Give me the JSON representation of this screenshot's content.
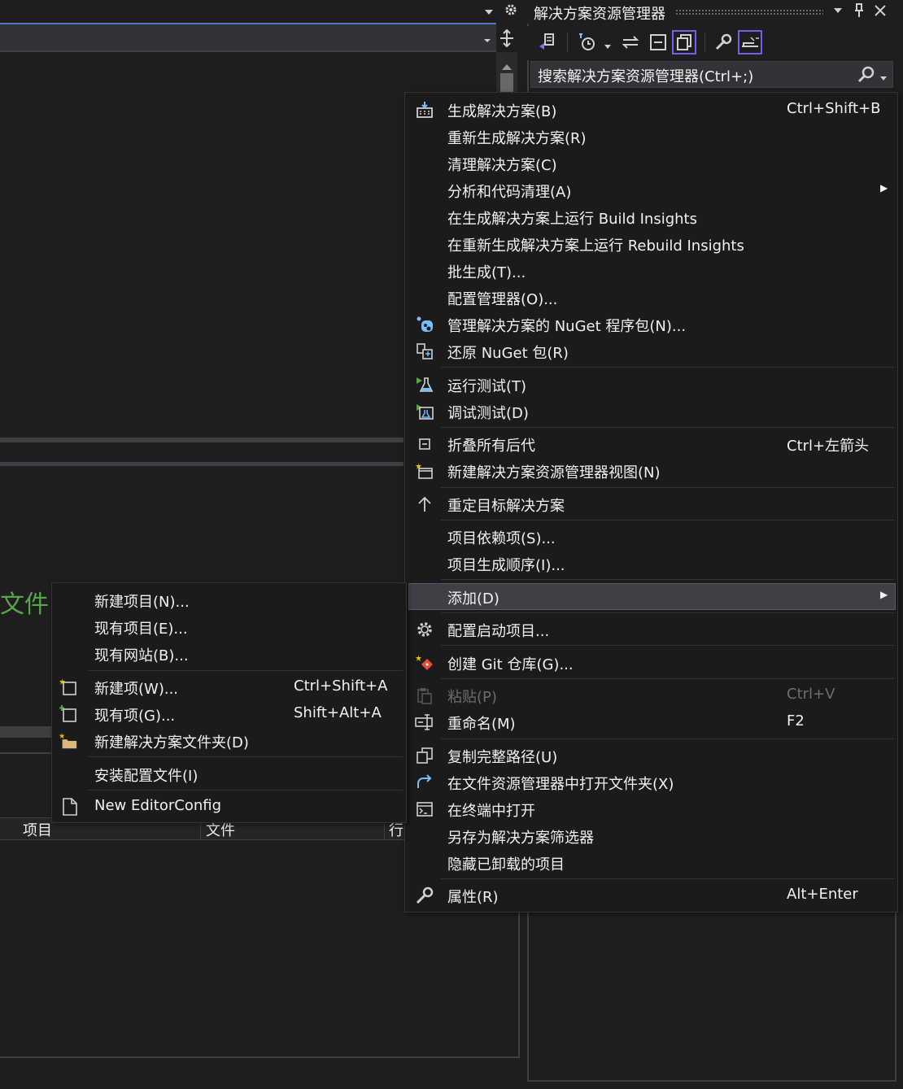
{
  "solution_explorer": {
    "title": "解决方案资源管理器",
    "search_placeholder": "搜索解决方案资源管理器(Ctrl+;)"
  },
  "lower_panel": {
    "green_label": "文件",
    "columns": [
      "项目",
      "文件",
      "行"
    ]
  },
  "main_menu": {
    "items": [
      {
        "label": "生成解决方案(B)",
        "shortcut": "Ctrl+Shift+B"
      },
      {
        "label": "重新生成解决方案(R)"
      },
      {
        "label": "清理解决方案(C)"
      },
      {
        "label": "分析和代码清理(A)"
      },
      {
        "label": "在生成解决方案上运行 Build Insights"
      },
      {
        "label": "在重新生成解决方案上运行 Rebuild Insights"
      },
      {
        "label": "批生成(T)..."
      },
      {
        "label": "配置管理器(O)..."
      },
      {
        "label": "管理解决方案的 NuGet 程序包(N)..."
      },
      {
        "label": "还原 NuGet 包(R)"
      },
      {
        "label": "运行测试(T)"
      },
      {
        "label": "调试测试(D)"
      },
      {
        "label": "折叠所有后代",
        "shortcut": "Ctrl+左箭头"
      },
      {
        "label": "新建解决方案资源管理器视图(N)"
      },
      {
        "label": "重定目标解决方案"
      },
      {
        "label": "项目依赖项(S)..."
      },
      {
        "label": "项目生成顺序(I)..."
      },
      {
        "label": "添加(D)"
      },
      {
        "label": "配置启动项目..."
      },
      {
        "label": "创建 Git 仓库(G)..."
      },
      {
        "label": "粘贴(P)",
        "shortcut": "Ctrl+V"
      },
      {
        "label": "重命名(M)",
        "shortcut": "F2"
      },
      {
        "label": "复制完整路径(U)"
      },
      {
        "label": "在文件资源管理器中打开文件夹(X)"
      },
      {
        "label": "在终端中打开"
      },
      {
        "label": "另存为解决方案筛选器"
      },
      {
        "label": "隐藏已卸载的项目"
      },
      {
        "label": "属性(R)",
        "shortcut": "Alt+Enter"
      }
    ]
  },
  "add_submenu": {
    "items": [
      {
        "label": "新建项目(N)..."
      },
      {
        "label": "现有项目(E)..."
      },
      {
        "label": "现有网站(B)..."
      },
      {
        "label": "新建项(W)...",
        "shortcut": "Ctrl+Shift+A"
      },
      {
        "label": "现有项(G)...",
        "shortcut": "Shift+Alt+A"
      },
      {
        "label": "新建解决方案文件夹(D)"
      },
      {
        "label": "安装配置文件(I)"
      },
      {
        "label": "New EditorConfig"
      }
    ]
  },
  "colors": {
    "background": "#1e1e1e",
    "menu_background": "#1b1b1c",
    "hover": "#3f3f46",
    "accent": "#7160e8",
    "green_text": "#57a64a"
  }
}
